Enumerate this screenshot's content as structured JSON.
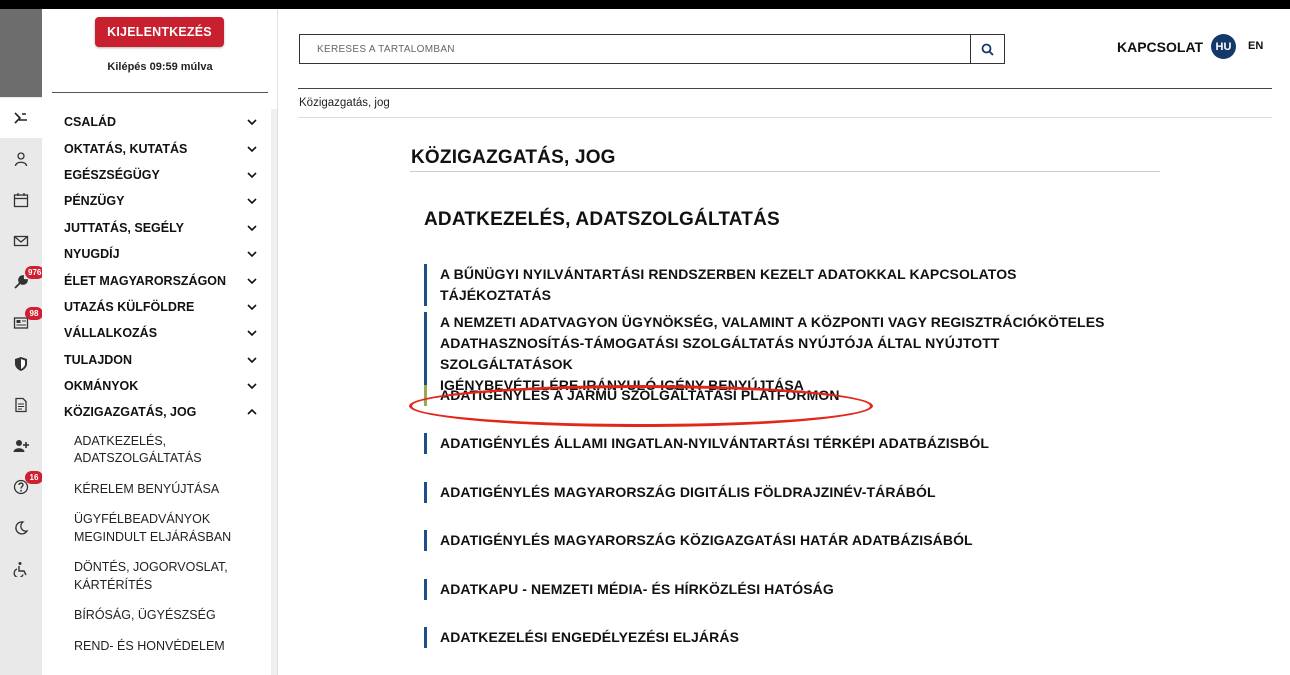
{
  "header": {
    "logout_label": "KIJELENTKEZÉS",
    "session_text": "Kilépés 09:59 múlva",
    "search_placeholder": "KERESÉS A TARTALOMBAN",
    "contact_label": "KAPCSOLAT",
    "lang_active": "HU",
    "lang_other": "EN"
  },
  "rail": {
    "icons": [
      "login-icon",
      "user-icon",
      "calendar-icon",
      "mail-icon",
      "wrench-icon",
      "news-icon",
      "shield-icon",
      "document-icon",
      "add-user-icon",
      "help-icon",
      "moon-icon",
      "accessibility-icon"
    ],
    "badges": {
      "wrench": "976",
      "news": "98",
      "help": "16"
    }
  },
  "sidebar": {
    "items": [
      {
        "label": "CSALÁD"
      },
      {
        "label": "OKTATÁS, KUTATÁS"
      },
      {
        "label": "EGÉSZSÉGÜGY"
      },
      {
        "label": "PÉNZÜGY"
      },
      {
        "label": "JUTTATÁS, SEGÉLY"
      },
      {
        "label": "NYUGDÍJ"
      },
      {
        "label": "ÉLET MAGYARORSZÁGON"
      },
      {
        "label": "UTAZÁS KÜLFÖLDRE"
      },
      {
        "label": "VÁLLALKOZÁS"
      },
      {
        "label": "TULAJDON"
      },
      {
        "label": "OKMÁNYOK"
      },
      {
        "label": "KÖZIGAZGATÁS, JOG"
      }
    ],
    "subitems": [
      {
        "line1": "ADATKEZELÉS,",
        "line2": "ADATSZOLGÁLTATÁS"
      },
      {
        "line1": "KÉRELEM BENYÚJTÁSA",
        "line2": ""
      },
      {
        "line1": "ÜGYFÉLBEADVÁNYOK",
        "line2": "MEGINDULT ELJÁRÁSBAN"
      },
      {
        "line1": "DÖNTÉS, JOGORVOSLAT,",
        "line2": "KÁRTÉRÍTÉS"
      },
      {
        "line1": "BÍRÓSÁG, ÜGYÉSZSÉG",
        "line2": ""
      },
      {
        "line1": "REND- ÉS HONVÉDELEM",
        "line2": ""
      }
    ]
  },
  "breadcrumb": "Közigazgatás, jog",
  "main": {
    "page_title": "KÖZIGAZGATÁS, JOG",
    "section_title": "ADATKEZELÉS, ADATSZOLGÁLTATÁS",
    "links": [
      {
        "line1": "A BŰNÜGYI NYILVÁNTARTÁSI RENDSZERBEN KEZELT ADATOKKAL KAPCSOLATOS TÁJÉKOZTATÁS",
        "line2": "",
        "line3": ""
      },
      {
        "line1": "A NEMZETI ADATVAGYON ÜGYNÖKSÉG, VALAMINT A KÖZPONTI VAGY REGISZTRÁCIÓKÖTELES",
        "line2": "ADATHASZNOSÍTÁS-TÁMOGATÁSI SZOLGÁLTATÁS NYÚJTÓJA ÁLTAL NYÚJTOTT SZOLGÁLTATÁSOK",
        "line3": "IGÉNYBEVÉTELÉRE IRÁNYULÓ IGÉNY BENYÚJTÁSA"
      },
      {
        "line1": "ADATIGÉNYLÉS A JÁRMŰ SZOLGÁLTATÁSI PLATFORMON",
        "line2": "",
        "line3": ""
      },
      {
        "line1": "ADATIGÉNYLÉS ÁLLAMI INGATLAN-NYILVÁNTARTÁSI TÉRKÉPI ADATBÁZISBÓL",
        "line2": "",
        "line3": ""
      },
      {
        "line1": "ADATIGÉNYLÉS MAGYARORSZÁG DIGITÁLIS FÖLDRAJZINÉV-TÁRÁBÓL",
        "line2": "",
        "line3": ""
      },
      {
        "line1": "ADATIGÉNYLÉS MAGYARORSZÁG KÖZIGAZGATÁSI HATÁR ADATBÁZISÁBÓL",
        "line2": "",
        "line3": ""
      },
      {
        "line1": "ADATKAPU - NEMZETI MÉDIA- ÉS HÍRKÖZLÉSI HATÓSÁG",
        "line2": "",
        "line3": ""
      },
      {
        "line1": "ADATKEZELÉSI ENGEDÉLYEZÉSI ELJÁRÁS",
        "line2": "",
        "line3": ""
      }
    ]
  },
  "colors": {
    "logout_red": "#c8202e",
    "link_bar_blue": "#1f4f86",
    "annotation_red": "#e3261a",
    "lang_badge": "#13386a"
  }
}
